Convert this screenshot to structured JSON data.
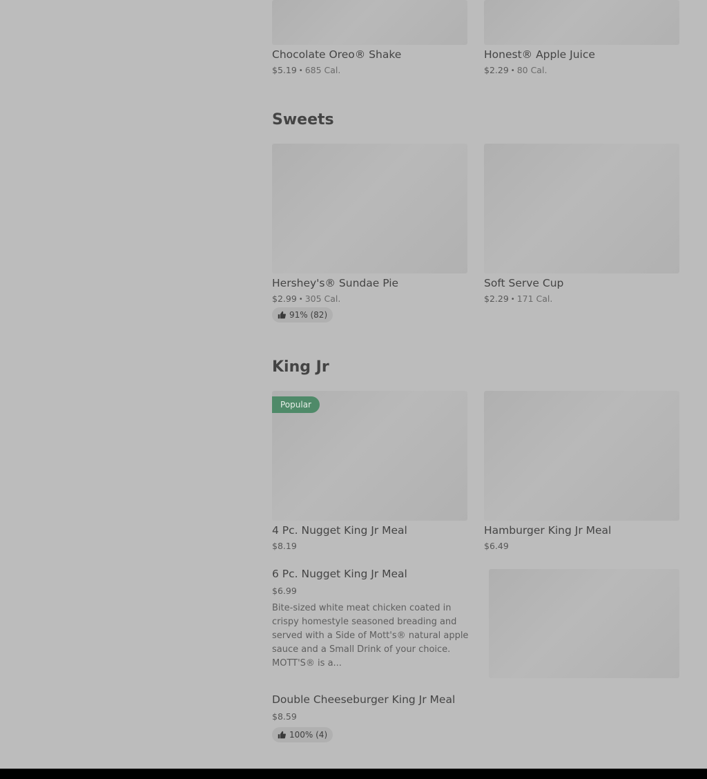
{
  "sections": {
    "drinks_tail": {
      "items": [
        {
          "name": "Chocolate Oreo® Shake",
          "price": "$5.19",
          "calories": "685 Cal."
        },
        {
          "name": "Honest® Apple Juice",
          "price": "$2.29",
          "calories": "80 Cal."
        }
      ]
    },
    "sweets": {
      "title": "Sweets",
      "items": [
        {
          "name": "Hershey's® Sundae Pie",
          "price": "$2.99",
          "calories": "305 Cal.",
          "rating": "91% (82)"
        },
        {
          "name": "Soft Serve Cup",
          "price": "$2.29",
          "calories": "171 Cal."
        }
      ]
    },
    "king_jr": {
      "title": "King Jr",
      "badge": "Popular",
      "items": [
        {
          "name": "4 Pc. Nugget King Jr Meal",
          "price": "$8.19"
        },
        {
          "name": "Hamburger King Jr Meal",
          "price": "$6.49"
        }
      ],
      "list_items": [
        {
          "name": "6 Pc. Nugget King Jr Meal",
          "price": "$6.99",
          "description": "Bite-sized white meat chicken coated in crispy homestyle seasoned breading and served with a Side of Mott's® natural apple sauce and a Small Drink of your choice. MOTT'S® is a..."
        },
        {
          "name": "Double Cheeseburger King Jr Meal",
          "price": "$8.59",
          "rating": "100% (4)"
        }
      ]
    }
  },
  "colors": {
    "background": "#bcbcbc",
    "popular_badge": "#4f8a69",
    "footer": "#000000"
  },
  "icons": {
    "rating": "thumbs-up-icon"
  }
}
